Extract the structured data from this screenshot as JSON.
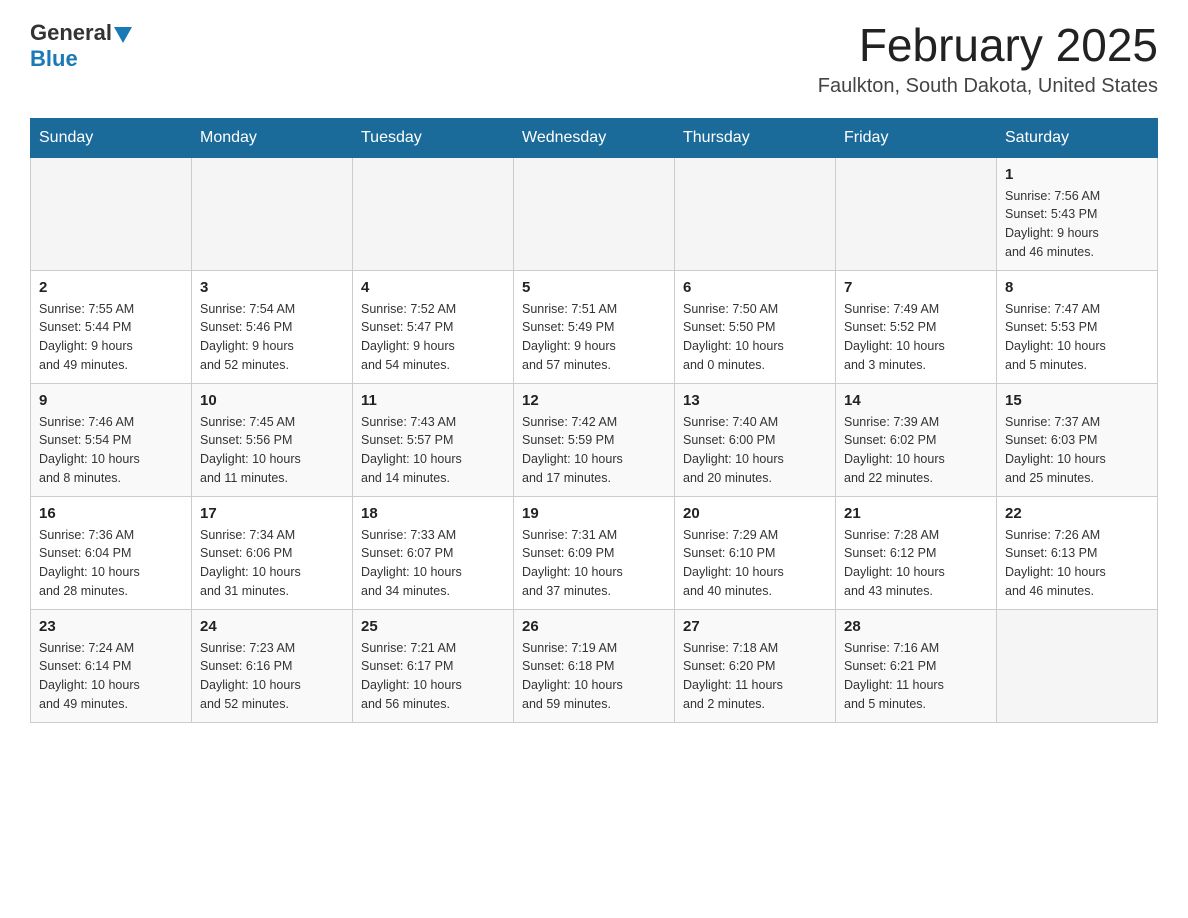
{
  "header": {
    "logo": {
      "general": "General",
      "blue": "Blue"
    },
    "title": "February 2025",
    "location": "Faulkton, South Dakota, United States"
  },
  "weekdays": [
    "Sunday",
    "Monday",
    "Tuesday",
    "Wednesday",
    "Thursday",
    "Friday",
    "Saturday"
  ],
  "weeks": [
    [
      {
        "day": "",
        "info": ""
      },
      {
        "day": "",
        "info": ""
      },
      {
        "day": "",
        "info": ""
      },
      {
        "day": "",
        "info": ""
      },
      {
        "day": "",
        "info": ""
      },
      {
        "day": "",
        "info": ""
      },
      {
        "day": "1",
        "info": "Sunrise: 7:56 AM\nSunset: 5:43 PM\nDaylight: 9 hours\nand 46 minutes."
      }
    ],
    [
      {
        "day": "2",
        "info": "Sunrise: 7:55 AM\nSunset: 5:44 PM\nDaylight: 9 hours\nand 49 minutes."
      },
      {
        "day": "3",
        "info": "Sunrise: 7:54 AM\nSunset: 5:46 PM\nDaylight: 9 hours\nand 52 minutes."
      },
      {
        "day": "4",
        "info": "Sunrise: 7:52 AM\nSunset: 5:47 PM\nDaylight: 9 hours\nand 54 minutes."
      },
      {
        "day": "5",
        "info": "Sunrise: 7:51 AM\nSunset: 5:49 PM\nDaylight: 9 hours\nand 57 minutes."
      },
      {
        "day": "6",
        "info": "Sunrise: 7:50 AM\nSunset: 5:50 PM\nDaylight: 10 hours\nand 0 minutes."
      },
      {
        "day": "7",
        "info": "Sunrise: 7:49 AM\nSunset: 5:52 PM\nDaylight: 10 hours\nand 3 minutes."
      },
      {
        "day": "8",
        "info": "Sunrise: 7:47 AM\nSunset: 5:53 PM\nDaylight: 10 hours\nand 5 minutes."
      }
    ],
    [
      {
        "day": "9",
        "info": "Sunrise: 7:46 AM\nSunset: 5:54 PM\nDaylight: 10 hours\nand 8 minutes."
      },
      {
        "day": "10",
        "info": "Sunrise: 7:45 AM\nSunset: 5:56 PM\nDaylight: 10 hours\nand 11 minutes."
      },
      {
        "day": "11",
        "info": "Sunrise: 7:43 AM\nSunset: 5:57 PM\nDaylight: 10 hours\nand 14 minutes."
      },
      {
        "day": "12",
        "info": "Sunrise: 7:42 AM\nSunset: 5:59 PM\nDaylight: 10 hours\nand 17 minutes."
      },
      {
        "day": "13",
        "info": "Sunrise: 7:40 AM\nSunset: 6:00 PM\nDaylight: 10 hours\nand 20 minutes."
      },
      {
        "day": "14",
        "info": "Sunrise: 7:39 AM\nSunset: 6:02 PM\nDaylight: 10 hours\nand 22 minutes."
      },
      {
        "day": "15",
        "info": "Sunrise: 7:37 AM\nSunset: 6:03 PM\nDaylight: 10 hours\nand 25 minutes."
      }
    ],
    [
      {
        "day": "16",
        "info": "Sunrise: 7:36 AM\nSunset: 6:04 PM\nDaylight: 10 hours\nand 28 minutes."
      },
      {
        "day": "17",
        "info": "Sunrise: 7:34 AM\nSunset: 6:06 PM\nDaylight: 10 hours\nand 31 minutes."
      },
      {
        "day": "18",
        "info": "Sunrise: 7:33 AM\nSunset: 6:07 PM\nDaylight: 10 hours\nand 34 minutes."
      },
      {
        "day": "19",
        "info": "Sunrise: 7:31 AM\nSunset: 6:09 PM\nDaylight: 10 hours\nand 37 minutes."
      },
      {
        "day": "20",
        "info": "Sunrise: 7:29 AM\nSunset: 6:10 PM\nDaylight: 10 hours\nand 40 minutes."
      },
      {
        "day": "21",
        "info": "Sunrise: 7:28 AM\nSunset: 6:12 PM\nDaylight: 10 hours\nand 43 minutes."
      },
      {
        "day": "22",
        "info": "Sunrise: 7:26 AM\nSunset: 6:13 PM\nDaylight: 10 hours\nand 46 minutes."
      }
    ],
    [
      {
        "day": "23",
        "info": "Sunrise: 7:24 AM\nSunset: 6:14 PM\nDaylight: 10 hours\nand 49 minutes."
      },
      {
        "day": "24",
        "info": "Sunrise: 7:23 AM\nSunset: 6:16 PM\nDaylight: 10 hours\nand 52 minutes."
      },
      {
        "day": "25",
        "info": "Sunrise: 7:21 AM\nSunset: 6:17 PM\nDaylight: 10 hours\nand 56 minutes."
      },
      {
        "day": "26",
        "info": "Sunrise: 7:19 AM\nSunset: 6:18 PM\nDaylight: 10 hours\nand 59 minutes."
      },
      {
        "day": "27",
        "info": "Sunrise: 7:18 AM\nSunset: 6:20 PM\nDaylight: 11 hours\nand 2 minutes."
      },
      {
        "day": "28",
        "info": "Sunrise: 7:16 AM\nSunset: 6:21 PM\nDaylight: 11 hours\nand 5 minutes."
      },
      {
        "day": "",
        "info": ""
      }
    ]
  ]
}
